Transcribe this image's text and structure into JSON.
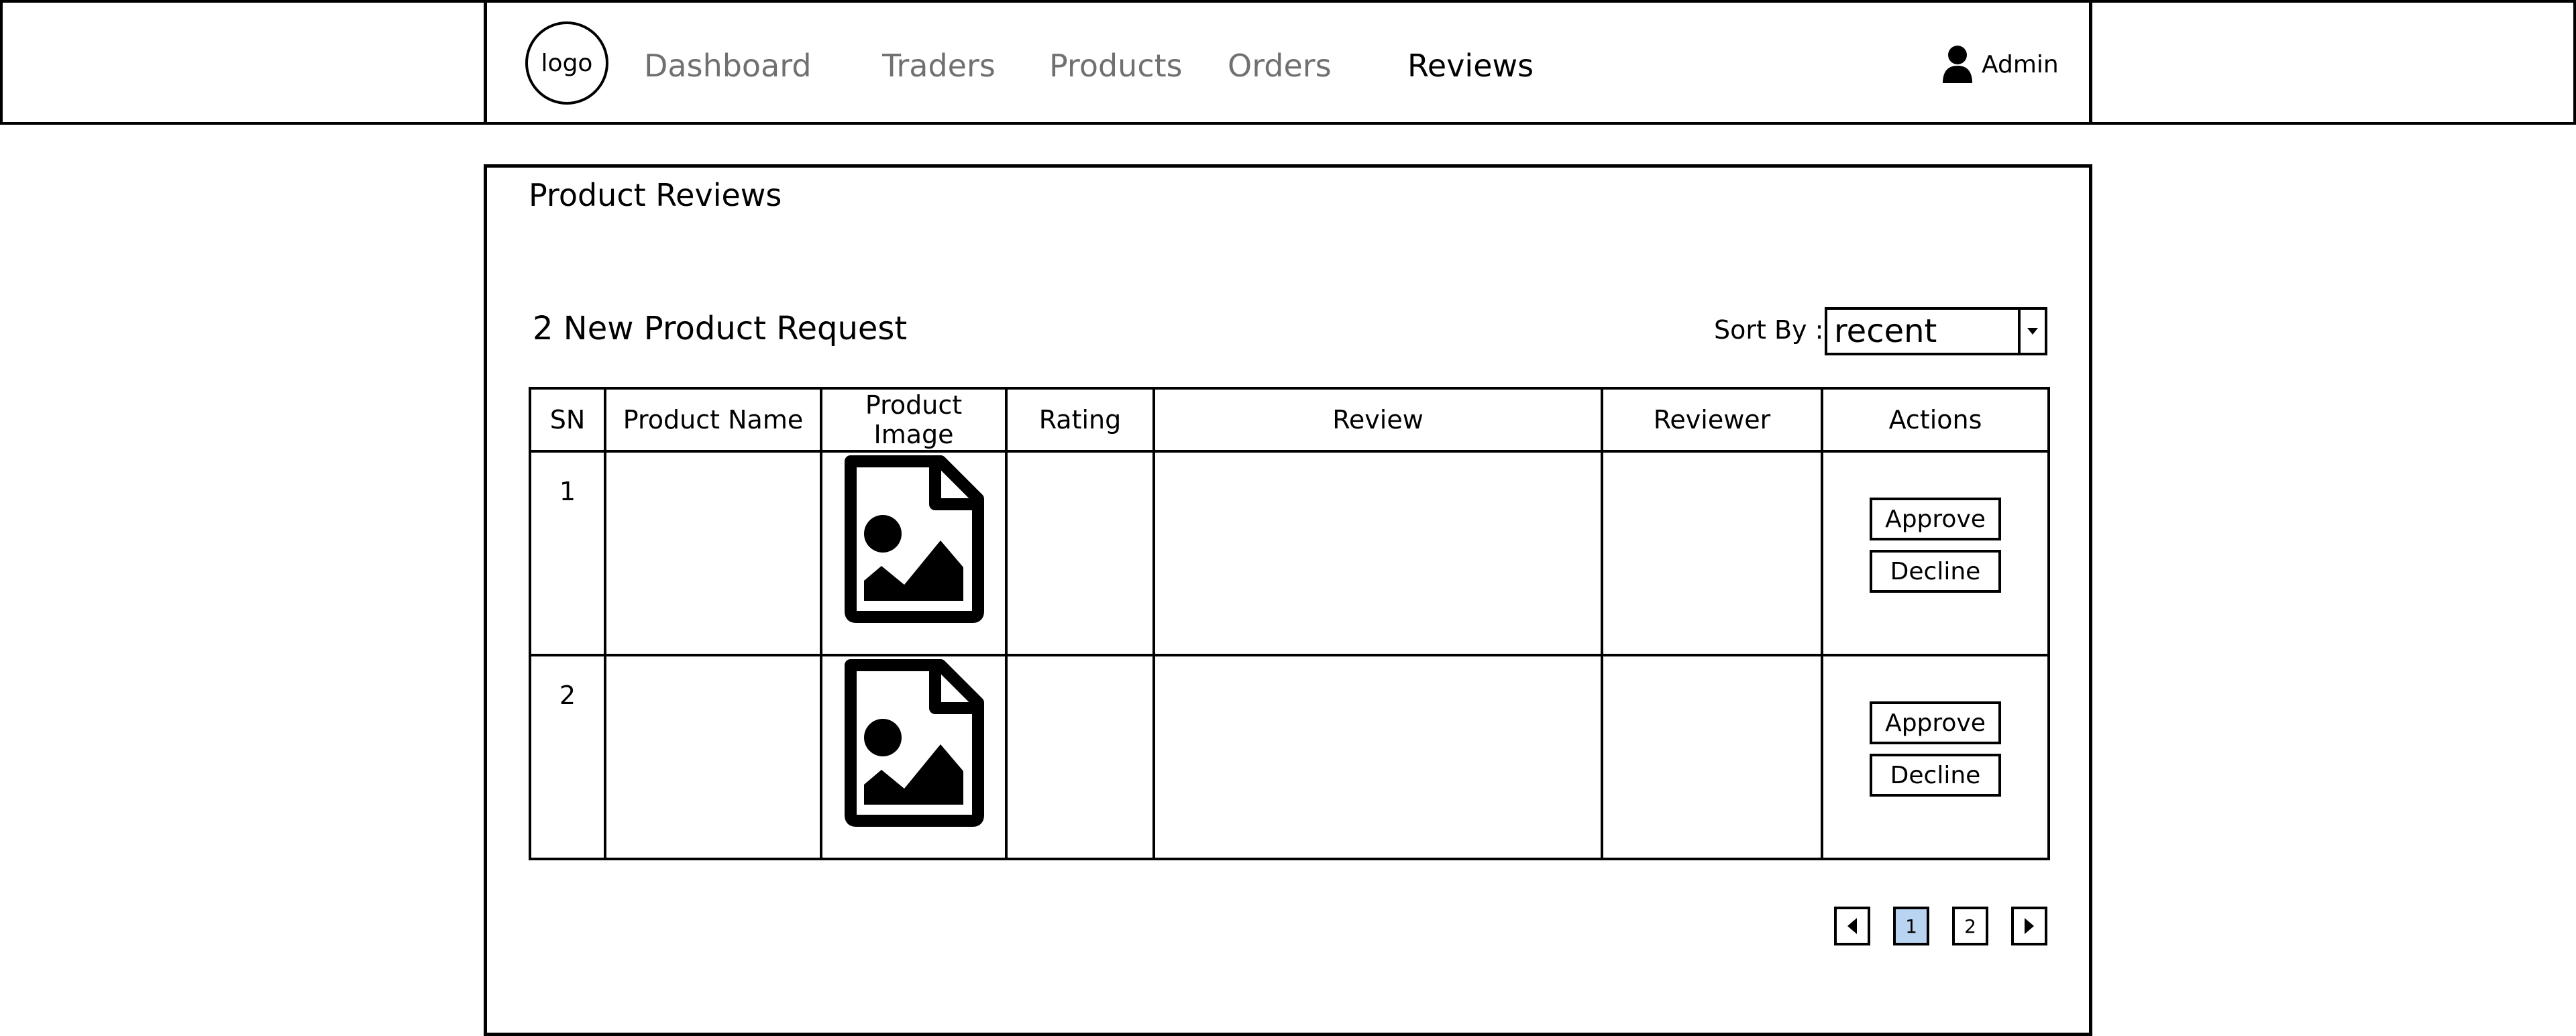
{
  "header": {
    "logo": "logo",
    "nav": [
      {
        "label": "Dashboard",
        "active": false
      },
      {
        "label": "Traders",
        "active": false
      },
      {
        "label": "Products",
        "active": false
      },
      {
        "label": "Orders",
        "active": false
      },
      {
        "label": "Reviews",
        "active": true
      }
    ],
    "user": {
      "icon": "user-icon",
      "label": "Admin"
    }
  },
  "main": {
    "title": "Product Reviews",
    "subtitle": "2 New Product Request",
    "sort": {
      "label": "Sort By :",
      "value": "recent"
    },
    "table": {
      "columns": [
        "SN",
        "Product Name",
        "Product Image",
        "Rating",
        "Review",
        "Reviewer",
        "Actions"
      ],
      "rows": [
        {
          "sn": "1",
          "product_name": "",
          "image_icon": "image-file-icon",
          "rating": "",
          "review": "",
          "reviewer": "",
          "approve": "Approve",
          "decline": "Decline"
        },
        {
          "sn": "2",
          "product_name": "",
          "image_icon": "image-file-icon",
          "rating": "",
          "review": "",
          "reviewer": "",
          "approve": "Approve",
          "decline": "Decline"
        }
      ]
    },
    "pagination": {
      "pages": [
        "1",
        "2"
      ],
      "current": "1"
    }
  },
  "colors": {
    "current_page": "#b8d4f0",
    "inactive_nav": "#707070",
    "active_nav": "#000000"
  }
}
